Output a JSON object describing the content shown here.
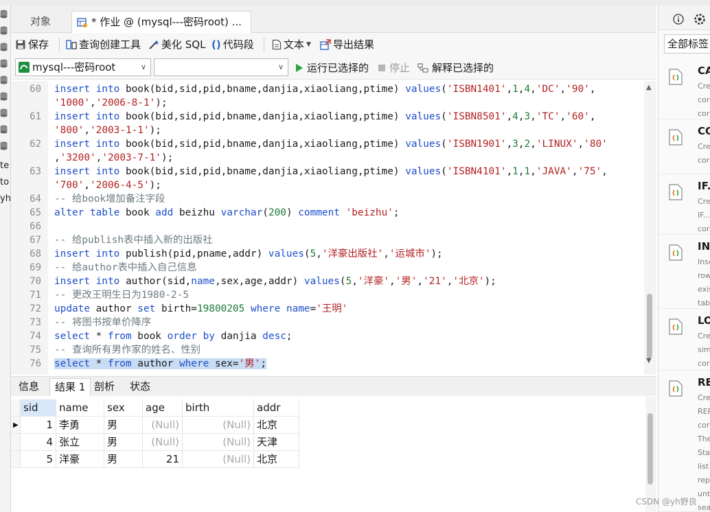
{
  "top_menu": [],
  "left_nav": {
    "labels": [
      "te",
      "to",
      "yh"
    ]
  },
  "tabs": {
    "objects": "对象",
    "query": "* 作业 @ (mysql---密码root) ..."
  },
  "toolbar": {
    "save": "保存",
    "query_builder": "查询创建工具",
    "beautify": "美化 SQL",
    "snippet": "代码段",
    "text": "文本",
    "export": "导出结果"
  },
  "toolbar2": {
    "connection": "mysql---密码root",
    "database": "",
    "run_selected": "运行已选择的",
    "stop": "停止",
    "explain_selected": "解释已选择的"
  },
  "editor": {
    "line_numbers": [
      "60",
      "",
      "61",
      "",
      "62",
      "",
      "63",
      "",
      "64",
      "65",
      "66",
      "67",
      "68",
      "69",
      "70",
      "71",
      "72",
      "73",
      "74",
      "75",
      "76"
    ],
    "lines": [
      [
        [
          "kw",
          "insert into"
        ],
        [
          "t",
          " book(bid,sid,pid,bname,danjia,xiaoliang,ptime) "
        ],
        [
          "kw",
          "values"
        ],
        [
          "t",
          "("
        ],
        [
          "str",
          "'ISBN1401'"
        ],
        [
          "t",
          ","
        ],
        [
          "num",
          "1"
        ],
        [
          "t",
          ","
        ],
        [
          "num",
          "4"
        ],
        [
          "t",
          ","
        ],
        [
          "str",
          "'DC'"
        ],
        [
          "t",
          ","
        ],
        [
          "str",
          "'90'"
        ],
        [
          "t",
          ","
        ]
      ],
      [
        [
          "str",
          "'1000'"
        ],
        [
          "t",
          ","
        ],
        [
          "str",
          "'2006-8-1'"
        ],
        [
          "t",
          ");"
        ]
      ],
      [
        [
          "kw",
          "insert into"
        ],
        [
          "t",
          " book(bid,sid,pid,bname,danjia,xiaoliang,ptime) "
        ],
        [
          "kw",
          "values"
        ],
        [
          "t",
          "("
        ],
        [
          "str",
          "'ISBN8501'"
        ],
        [
          "t",
          ","
        ],
        [
          "num",
          "4"
        ],
        [
          "t",
          ","
        ],
        [
          "num",
          "3"
        ],
        [
          "t",
          ","
        ],
        [
          "str",
          "'TC'"
        ],
        [
          "t",
          ","
        ],
        [
          "str",
          "'60'"
        ],
        [
          "t",
          ","
        ]
      ],
      [
        [
          "str",
          "'800'"
        ],
        [
          "t",
          ","
        ],
        [
          "str",
          "'2003-1-1'"
        ],
        [
          "t",
          ");"
        ]
      ],
      [
        [
          "kw",
          "insert into"
        ],
        [
          "t",
          " book(bid,sid,pid,bname,danjia,xiaoliang,ptime) "
        ],
        [
          "kw",
          "values"
        ],
        [
          "t",
          "("
        ],
        [
          "str",
          "'ISBN1901'"
        ],
        [
          "t",
          ","
        ],
        [
          "num",
          "3"
        ],
        [
          "t",
          ","
        ],
        [
          "num",
          "2"
        ],
        [
          "t",
          ","
        ],
        [
          "str",
          "'LINUX'"
        ],
        [
          "t",
          ","
        ],
        [
          "str",
          "'80'"
        ]
      ],
      [
        [
          "t",
          ","
        ],
        [
          "str",
          "'3200'"
        ],
        [
          "t",
          ","
        ],
        [
          "str",
          "'2003-7-1'"
        ],
        [
          "t",
          ");"
        ]
      ],
      [
        [
          "kw",
          "insert into"
        ],
        [
          "t",
          " book(bid,sid,pid,bname,danjia,xiaoliang,ptime) "
        ],
        [
          "kw",
          "values"
        ],
        [
          "t",
          "("
        ],
        [
          "str",
          "'ISBN4101'"
        ],
        [
          "t",
          ","
        ],
        [
          "num",
          "1"
        ],
        [
          "t",
          ","
        ],
        [
          "num",
          "1"
        ],
        [
          "t",
          ","
        ],
        [
          "str",
          "'JAVA'"
        ],
        [
          "t",
          ","
        ],
        [
          "str",
          "'75'"
        ],
        [
          "t",
          ","
        ]
      ],
      [
        [
          "str",
          "'700'"
        ],
        [
          "t",
          ","
        ],
        [
          "str",
          "'2006-4-5'"
        ],
        [
          "t",
          ");"
        ]
      ],
      [
        [
          "cm",
          "-- 给book增加备注字段"
        ]
      ],
      [
        [
          "kw",
          "alter table"
        ],
        [
          "t",
          " book "
        ],
        [
          "kw",
          "add"
        ],
        [
          "t",
          " beizhu "
        ],
        [
          "kw",
          "varchar"
        ],
        [
          "t",
          "("
        ],
        [
          "num",
          "200"
        ],
        [
          "t",
          ") "
        ],
        [
          "kw",
          "comment"
        ],
        [
          "t",
          " "
        ],
        [
          "str",
          "'beizhu'"
        ],
        [
          "t",
          ";"
        ]
      ],
      [],
      [
        [
          "cm",
          "-- 给publish表中插入新的出版社"
        ]
      ],
      [
        [
          "kw",
          "insert into"
        ],
        [
          "t",
          " publish(pid,pname,addr) "
        ],
        [
          "kw",
          "values"
        ],
        [
          "t",
          "("
        ],
        [
          "num",
          "5"
        ],
        [
          "t",
          ","
        ],
        [
          "str",
          "'洋豪出版社'"
        ],
        [
          "t",
          ","
        ],
        [
          "str",
          "'运城市'"
        ],
        [
          "t",
          ");"
        ]
      ],
      [
        [
          "cm",
          "-- 给author表中插入自己信息"
        ]
      ],
      [
        [
          "kw",
          "insert into"
        ],
        [
          "t",
          " author(sid,"
        ],
        [
          "kw",
          "name"
        ],
        [
          "t",
          ",sex,age,addr) "
        ],
        [
          "kw",
          "values"
        ],
        [
          "t",
          "("
        ],
        [
          "num",
          "5"
        ],
        [
          "t",
          ","
        ],
        [
          "str",
          "'洋豪'"
        ],
        [
          "t",
          ","
        ],
        [
          "str",
          "'男'"
        ],
        [
          "t",
          ","
        ],
        [
          "str",
          "'21'"
        ],
        [
          "t",
          ","
        ],
        [
          "str",
          "'北京'"
        ],
        [
          "t",
          ");"
        ]
      ],
      [
        [
          "cm",
          "-- 更改王明生日为1980-2-5"
        ]
      ],
      [
        [
          "kw",
          "update"
        ],
        [
          "t",
          " author "
        ],
        [
          "kw",
          "set"
        ],
        [
          "t",
          " birth="
        ],
        [
          "num",
          "19800205"
        ],
        [
          "t",
          " "
        ],
        [
          "kw",
          "where"
        ],
        [
          "t",
          " "
        ],
        [
          "kw",
          "name"
        ],
        [
          "t",
          "="
        ],
        [
          "str",
          "'王明'"
        ]
      ],
      [
        [
          "cm",
          "-- 将图书按单价降序"
        ]
      ],
      [
        [
          "kw",
          "select"
        ],
        [
          "t",
          " * "
        ],
        [
          "kw",
          "from"
        ],
        [
          "t",
          " book "
        ],
        [
          "kw",
          "order by"
        ],
        [
          "t",
          " danjia "
        ],
        [
          "kw",
          "desc"
        ],
        [
          "t",
          ";"
        ]
      ],
      [
        [
          "cm",
          "-- 查询所有男作家的姓名、性别"
        ]
      ],
      [
        [
          "kw",
          "select"
        ],
        [
          "t",
          " * "
        ],
        [
          "kw",
          "from"
        ],
        [
          "t",
          " author "
        ],
        [
          "kw",
          "where"
        ],
        [
          "t",
          " sex="
        ],
        [
          "str",
          "'男'"
        ],
        [
          "t",
          ";"
        ]
      ]
    ],
    "selected_line": 20
  },
  "result_tabs": [
    "信息",
    "结果 1",
    "剖析",
    "状态"
  ],
  "result_active": "结果 1",
  "grid": {
    "columns": [
      "sid",
      "name",
      "sex",
      "age",
      "birth",
      "addr"
    ],
    "rows": [
      [
        "1",
        "李勇",
        "男",
        "(Null)",
        "(Null)",
        "北京"
      ],
      [
        "4",
        "张立",
        "男",
        "(Null)",
        "(Null)",
        "天津"
      ],
      [
        "5",
        "洋豪",
        "男",
        "21",
        "(Null)",
        "北京"
      ]
    ]
  },
  "right_panel": {
    "filter": "全部标签",
    "snippets": [
      {
        "title": "CA",
        "desc": "Cre\ncor\ncor"
      },
      {
        "title": "CO",
        "desc": "Cre\ncor"
      },
      {
        "title": "IF..",
        "desc": "Cre\nIF...\ncor"
      },
      {
        "title": "IN",
        "desc": "Inse\nrow\nexis\ntab"
      },
      {
        "title": "LO",
        "desc": "Cre\nsim\ncor"
      },
      {
        "title": "RE",
        "desc": "Cre\nREP\ncor\nThe\nSta\nlist\nrep\nunt\nsea\nexp"
      }
    ]
  },
  "watermark": "CSDN @yh野良",
  "colors": {
    "keyword": "#1d4ec9",
    "string": "#b31f1f",
    "number": "#1e7a38",
    "comment": "#6e7b82",
    "selection": "#c8dcf3",
    "run_green": "#2aa33a"
  }
}
